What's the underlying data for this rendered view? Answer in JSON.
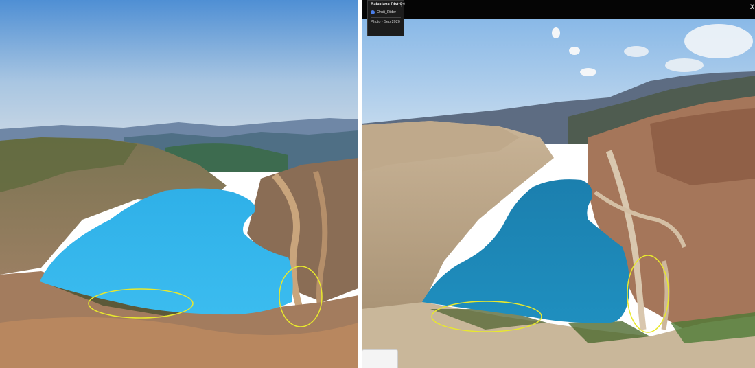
{
  "colors": {
    "left_lake": "#33b6ea",
    "right_lake": "#1f86b4",
    "circle_stroke": "#e8e82e",
    "overlay_bg": "#1c1c1c",
    "topbar_bg": "#050505"
  },
  "right_panel": {
    "overlay": {
      "title": "Balaklava District",
      "author": "Ornit_Rider",
      "date": "Photo - Sep 2020"
    },
    "close_label": "x"
  }
}
